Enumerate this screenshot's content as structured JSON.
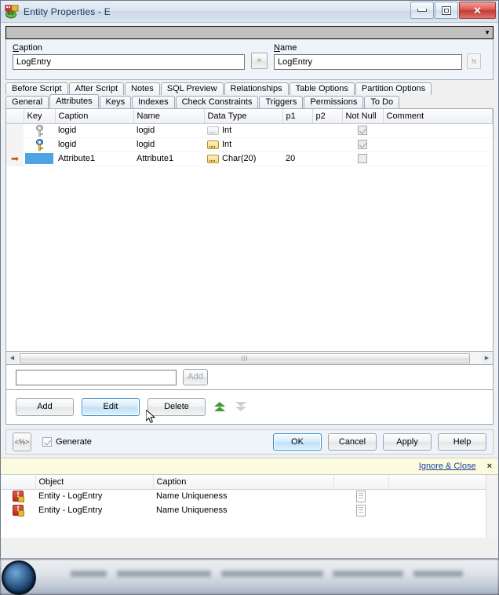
{
  "window": {
    "title": "Entity Properties - E",
    "icon": "entity-icon",
    "buttons": {
      "minimize": "minimize",
      "maximize": "maximize",
      "close": "close"
    }
  },
  "form": {
    "caption_label": "Caption",
    "caption_value": "LogEntry",
    "equals_button": "=",
    "name_label": "Name",
    "name_value": "LogEntry",
    "name_side_button": "N"
  },
  "tabs": {
    "row1": [
      {
        "label": "Before Script",
        "active": false
      },
      {
        "label": "After Script",
        "active": false
      },
      {
        "label": "Notes",
        "active": false
      },
      {
        "label": "SQL Preview",
        "active": false
      },
      {
        "label": "Relationships",
        "active": false
      },
      {
        "label": "Table Options",
        "active": false
      },
      {
        "label": "Partition Options",
        "active": false
      }
    ],
    "row2": [
      {
        "label": "General",
        "active": false
      },
      {
        "label": "Attributes",
        "active": true
      },
      {
        "label": "Keys",
        "active": false
      },
      {
        "label": "Indexes",
        "active": false
      },
      {
        "label": "Check Constraints",
        "active": false
      },
      {
        "label": "Triggers",
        "active": false
      },
      {
        "label": "Permissions",
        "active": false
      },
      {
        "label": "To Do",
        "active": false
      }
    ]
  },
  "grid": {
    "columns": [
      "",
      "Key",
      "Caption",
      "Name",
      "Data Type",
      "p1",
      "p2",
      "Not Null",
      "Comment"
    ],
    "rows": [
      {
        "marker": "",
        "key_icon": "key-icon-inherited",
        "caption": "logid",
        "name": "logid",
        "data_type": "Int",
        "p1": "",
        "p2": "",
        "not_null": true,
        "not_null_enabled": false,
        "comment": "",
        "dimmed": true,
        "selected": false
      },
      {
        "marker": "",
        "key_icon": "key-icon",
        "caption": "logid",
        "name": "logid",
        "data_type": "Int",
        "p1": "",
        "p2": "",
        "not_null": true,
        "not_null_enabled": false,
        "comment": "",
        "dimmed": false,
        "selected": false
      },
      {
        "marker": "➡",
        "key_icon": "",
        "caption": "Attribute1",
        "name": "Attribute1",
        "data_type": "Char(20)",
        "p1": "20",
        "p2": "",
        "not_null": false,
        "not_null_enabled": true,
        "comment": "",
        "dimmed": false,
        "selected": true
      }
    ]
  },
  "quick_add": {
    "input_value": "",
    "input_placeholder": "",
    "add_label": "Add"
  },
  "actions": {
    "add_label": "Add",
    "edit_label": "Edit",
    "delete_label": "Delete",
    "move_up_icon": "double-chevron-up-icon",
    "move_down_icon": "double-chevron-down-icon"
  },
  "footer": {
    "code_button": "<%>",
    "generate_label": "Generate",
    "generate_checked": true,
    "ok_label": "OK",
    "cancel_label": "Cancel",
    "apply_label": "Apply",
    "help_label": "Help"
  },
  "warning_strip": {
    "ignore_close_label": "Ignore & Close",
    "close_label": "×"
  },
  "error_list": {
    "columns": [
      "",
      "Object",
      "Caption",
      "",
      ""
    ],
    "rows": [
      {
        "icon": "error-icon",
        "object": "Entity - LogEntry",
        "caption": "Name Uniqueness",
        "note_icon": "note-icon"
      },
      {
        "icon": "error-icon",
        "object": "Entity - LogEntry",
        "caption": "Name Uniqueness",
        "note_icon": "note-icon"
      }
    ]
  },
  "taskbar": {
    "start_icon": "start-orb-icon"
  },
  "colors": {
    "selection": "#4fa3e3",
    "accent_focus": "#3c8ac4",
    "warning_bg": "#fbfbdf",
    "error_red": "#bb2a1c",
    "link": "#1a3fa0"
  }
}
